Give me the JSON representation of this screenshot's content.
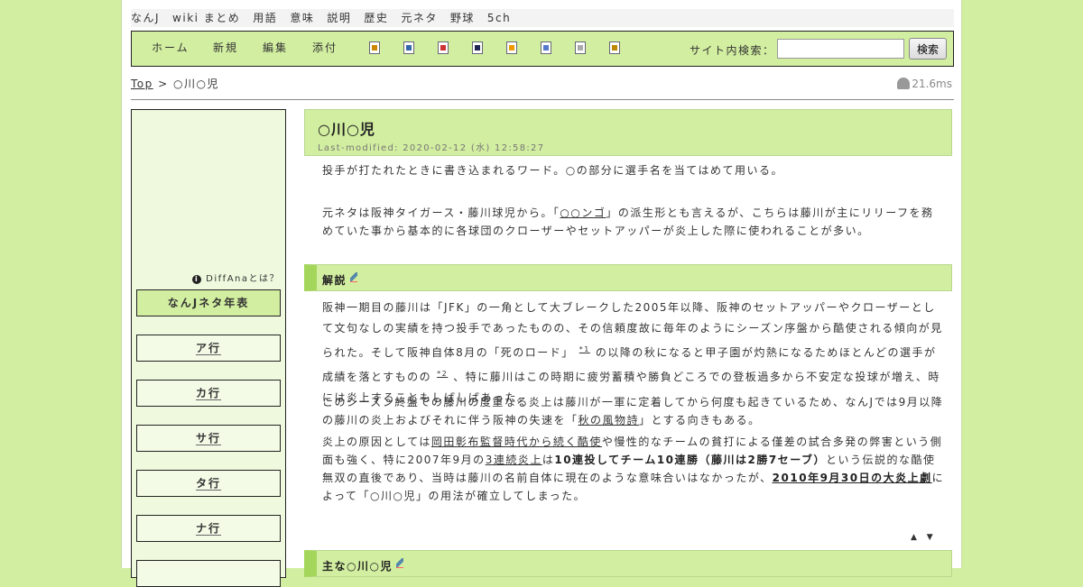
{
  "header_links": [
    "なんJ",
    "wiki まとめ",
    "用語",
    "意味",
    "説明",
    "歴史",
    "元ネタ",
    "野球",
    "5ch"
  ],
  "toolbar": {
    "home": "ホーム",
    "new": "新規",
    "edit": "編集",
    "attach": "添付",
    "search_label": "サイト内検索：",
    "search_value": "",
    "search_button": "検索",
    "icons": [
      "new-page-icon",
      "copy-page-icon",
      "diff-icon",
      "backup-icon",
      "freeze-icon",
      "rename-icon",
      "list-icon",
      "help-icon"
    ]
  },
  "breadcrumb": {
    "root": "Top",
    "sep": ">",
    "current": "○川○児"
  },
  "timing": "21.6ms",
  "sidebar": {
    "diffana": "DiffAnaとは？",
    "items": [
      "なんJネタ年表",
      "ア行",
      "カ行",
      "サ行",
      "タ行",
      "ナ行",
      ""
    ]
  },
  "page": {
    "title": "○川○児",
    "modified": "Last-modified: 2020-02-12 (水) 12:58:27",
    "intro1": "投手が打たれたときに書き込まれるワード。○の部分に選手名を当てはめて用いる。",
    "intro2_a": "元ネタは阪神タイガース・藤川球児から。「",
    "intro2_link": "○○ンゴ",
    "intro2_b": "」の派生形とも言えるが、こちらは藤川が主にリリーフを務めていた事から基本的に各球団のクローザーやセットアッパーが炎上した際に使われることが多い。"
  },
  "section1": {
    "title": "解説",
    "p1_a": "阪神一期目の藤川は「JFK」の一角として大ブレークした2005年以降、阪神のセットアッパーやクローザーとして文句なしの実績を持つ投手であったものの、その信頼度故に毎年のようにシーズン序盤から酷使される傾向が見られた。そして阪神自体8月の「死のロード」",
    "fn1": "*1",
    "p1_b": "の以降の秋になると甲子園が灼熱になるためほとんどの選手が成績を落とすものの",
    "fn2": "*2",
    "p1_c": "、特に藤川はこの時期に疲労蓄積や勝負どころでの登板過多から不安定な投球が増え、時には炎上することもしばしばあった。",
    "p2_a": "このシーズン終盤での藤川の度重なる炎上は藤川が一軍に定着してから何度も起きているため、なんJでは9月以降の藤川の炎上およびそれに伴う阪神の失速を「",
    "p2_link": "秋の風物詩",
    "p2_b": "」とする向きもある。",
    "p3_a": "炎上の原因としては",
    "p3_link1": "岡田彰布監督時代から続く酷使",
    "p3_b": "や慢性的なチームの貧打による僅差の試合多発の弊害という側面も強く、特に2007年9月の",
    "p3_link2": "3連続炎上",
    "p3_c": "は",
    "p3_bold": "10連投してチーム10連勝（藤川は2勝7セーブ）",
    "p3_d": "という伝説的な酷使無双の直後であり、当時は藤川の名前自体に現在のような意味合いはなかったが、",
    "p3_link3": "2010年9月30日の大炎上劇",
    "p3_e": "によって「○川○児」の用法が確立してしまった。",
    "updown": "▲ ▼"
  },
  "section2": {
    "title": "主な○川○児"
  }
}
